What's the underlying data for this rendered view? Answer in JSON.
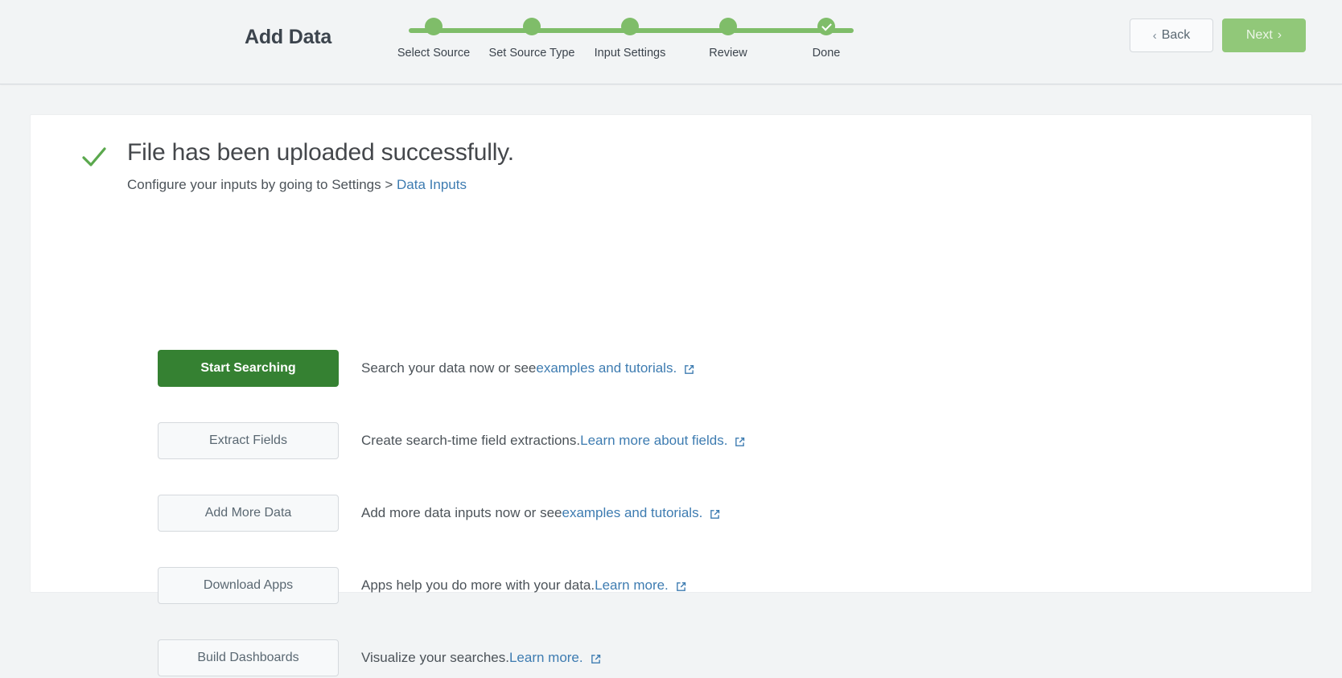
{
  "header": {
    "title": "Add Data",
    "steps": [
      {
        "label": "Select Source",
        "state": "complete"
      },
      {
        "label": "Set Source Type",
        "state": "complete"
      },
      {
        "label": "Input Settings",
        "state": "complete"
      },
      {
        "label": "Review",
        "state": "complete"
      },
      {
        "label": "Done",
        "state": "current-check"
      }
    ],
    "back_label": "Back",
    "next_label": "Next",
    "back_chevron": "‹",
    "next_chevron": "›"
  },
  "colors": {
    "progress_green": "#7fbd69",
    "primary_green": "#358132",
    "next_green": "#8cc673",
    "link_blue": "#3e7cb1",
    "page_background": "#f2f4f5"
  },
  "main": {
    "success_icon": "check-icon",
    "title": "File has been uploaded successfully.",
    "subtitle_prefix": "Configure your inputs by going to Settings > ",
    "subtitle_link": "Data Inputs",
    "actions": [
      {
        "button_label": "Start Searching",
        "style": "primary",
        "desc_prefix": "Search your data now or see ",
        "desc_link": "examples and tutorials.",
        "desc_suffix": "",
        "external_icon": "external-link-icon"
      },
      {
        "button_label": "Extract Fields",
        "style": "secondary",
        "desc_prefix": "Create search-time field extractions. ",
        "desc_link": "Learn more about fields.",
        "desc_suffix": "",
        "external_icon": "external-link-icon"
      },
      {
        "button_label": "Add More Data",
        "style": "secondary",
        "desc_prefix": "Add more data inputs now or see ",
        "desc_link": "examples and tutorials.",
        "desc_suffix": "",
        "external_icon": "external-link-icon"
      },
      {
        "button_label": "Download Apps",
        "style": "secondary",
        "desc_prefix": "Apps help you do more with your data. ",
        "desc_link": "Learn more.",
        "desc_suffix": "",
        "external_icon": "external-link-icon"
      },
      {
        "button_label": "Build Dashboards",
        "style": "secondary",
        "desc_prefix": "Visualize your searches. ",
        "desc_link": "Learn more.",
        "desc_suffix": "",
        "external_icon": "external-link-icon"
      }
    ]
  }
}
